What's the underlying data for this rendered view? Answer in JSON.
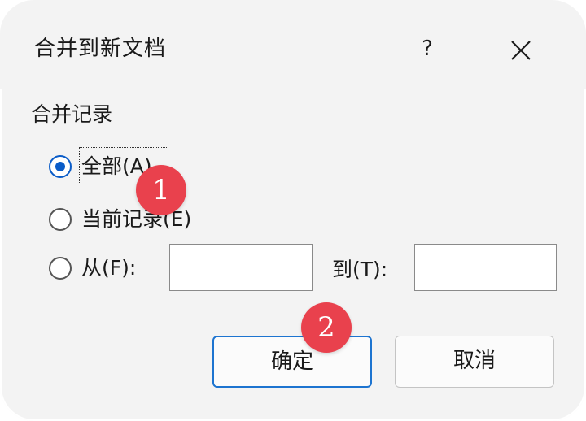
{
  "dialog": {
    "title": "合并到新文档",
    "help_label": "?",
    "close_icon": "close-icon"
  },
  "group": {
    "title": "合并记录"
  },
  "options": {
    "all": {
      "label": "全部(A)",
      "checked": true
    },
    "current": {
      "label": "当前记录(E)",
      "checked": false
    },
    "range": {
      "label": "从(F):",
      "checked": false
    }
  },
  "range": {
    "from_value": "",
    "to_label": "到(T):",
    "to_value": ""
  },
  "buttons": {
    "ok_label": "确定",
    "cancel_label": "取消"
  },
  "annotations": {
    "step1": "1",
    "step2": "2",
    "color": "#e9414d"
  },
  "colors": {
    "accent": "#0a5cc8",
    "dialog_bg": "#f3f3f3"
  }
}
